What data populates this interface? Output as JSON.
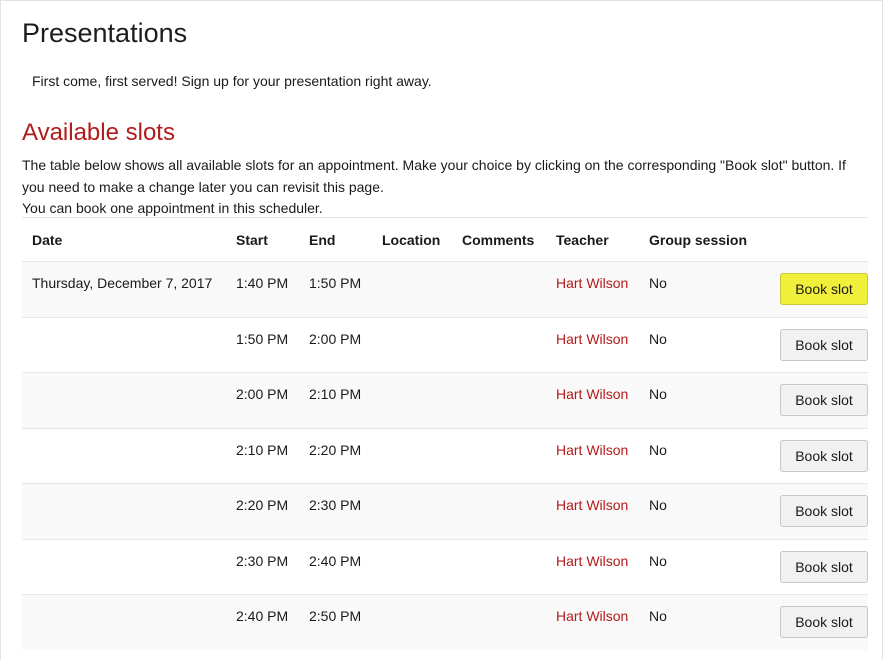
{
  "page": {
    "title": "Presentations",
    "intro": "First come, first served! Sign up for your presentation right away."
  },
  "section": {
    "title": "Available slots",
    "description_line1": "The table below shows all available slots for an appointment. Make your choice by clicking on the corresponding \"Book slot\" button. If you need to make a change later you can revisit this page.",
    "description_line2": "You can book one appointment in this scheduler."
  },
  "table": {
    "headers": {
      "date": "Date",
      "start": "Start",
      "end": "End",
      "location": "Location",
      "comments": "Comments",
      "teacher": "Teacher",
      "group_session": "Group session"
    },
    "rows": [
      {
        "date": "Thursday, December 7, 2017",
        "start": "1:40 PM",
        "end": "1:50 PM",
        "location": "",
        "comments": "",
        "teacher": "Hart Wilson",
        "group": "No",
        "button": "Book slot",
        "highlight": true
      },
      {
        "date": "",
        "start": "1:50 PM",
        "end": "2:00 PM",
        "location": "",
        "comments": "",
        "teacher": "Hart Wilson",
        "group": "No",
        "button": "Book slot",
        "highlight": false
      },
      {
        "date": "",
        "start": "2:00 PM",
        "end": "2:10 PM",
        "location": "",
        "comments": "",
        "teacher": "Hart Wilson",
        "group": "No",
        "button": "Book slot",
        "highlight": false
      },
      {
        "date": "",
        "start": "2:10 PM",
        "end": "2:20 PM",
        "location": "",
        "comments": "",
        "teacher": "Hart Wilson",
        "group": "No",
        "button": "Book slot",
        "highlight": false
      },
      {
        "date": "",
        "start": "2:20 PM",
        "end": "2:30 PM",
        "location": "",
        "comments": "",
        "teacher": "Hart Wilson",
        "group": "No",
        "button": "Book slot",
        "highlight": false
      },
      {
        "date": "",
        "start": "2:30 PM",
        "end": "2:40 PM",
        "location": "",
        "comments": "",
        "teacher": "Hart Wilson",
        "group": "No",
        "button": "Book slot",
        "highlight": false
      },
      {
        "date": "",
        "start": "2:40 PM",
        "end": "2:50 PM",
        "location": "",
        "comments": "",
        "teacher": "Hart Wilson",
        "group": "No",
        "button": "Book slot",
        "highlight": false
      }
    ]
  },
  "colors": {
    "accent_red": "#b31b1b",
    "highlight_button": "#f0ef3a",
    "stripe": "#f9f9f9"
  }
}
